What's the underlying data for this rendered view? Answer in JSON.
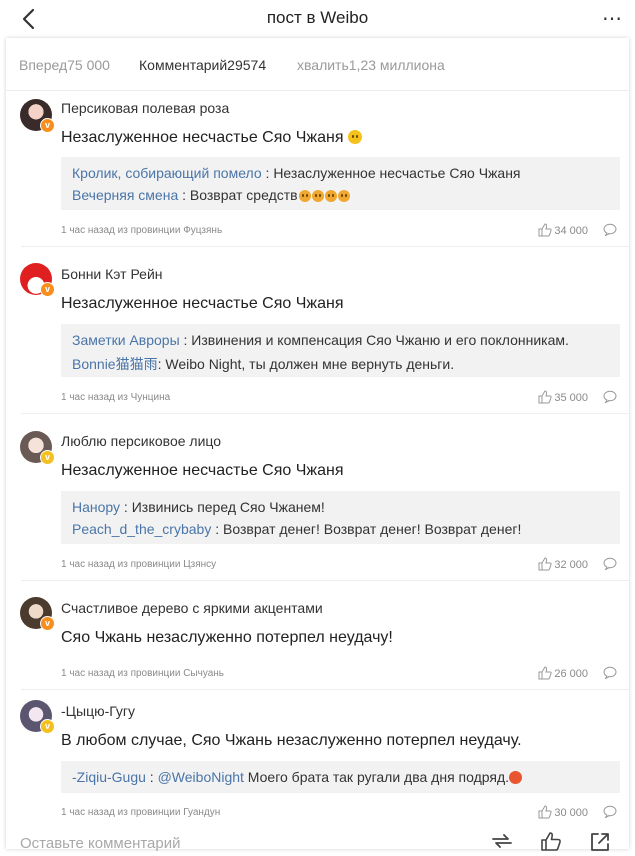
{
  "header": {
    "title": "пост в Weibo"
  },
  "tabs": {
    "forward": "Вперед75 000",
    "comments": "Комментарий29574",
    "likes": "хвалить1,23 миллиона"
  },
  "comments": [
    {
      "user": "Персиковая полевая роза",
      "text": "Незаслуженное несчастье Сяо Чжаня",
      "replies": [
        {
          "user": "Кролик, собирающий помело",
          "text": " : Незаслуженное несчастье Сяо Чжаня"
        },
        {
          "user": "Вечерняя смена",
          "text": " : Возврат средств"
        }
      ],
      "meta": "1 час назад из провинции Фуцзянь",
      "likes": "34 000"
    },
    {
      "user": "Бонни Кэт Рейн",
      "text": "Незаслуженное несчастье Сяо Чжаня",
      "replies": [
        {
          "user": "Заметки Авроры",
          "text": " : Извинения и компенсация Сяо Чжаню и его поклонникам."
        },
        {
          "user": "Bonnie猫猫雨",
          "text": ": Weibo Night, ты должен мне вернуть деньги."
        }
      ],
      "meta": "1 час назад из Чунцина",
      "likes": "35 000"
    },
    {
      "user": "Люблю персиковое лицо",
      "text": "Незаслуженное несчастье Сяо Чжаня",
      "replies": [
        {
          "user": "Нанору",
          "text": " : Извинись перед Сяо Чжанем!"
        },
        {
          "user": "Peach_d_the_crybaby",
          "text": " : Возврат денег! Возврат денег! Возврат денег!"
        }
      ],
      "meta": "1 час назад из провинции Цзянсу",
      "likes": "32 000"
    },
    {
      "user": "Счастливое дерево с яркими акцентами",
      "text": "Сяо Чжань незаслуженно потерпел неудачу!",
      "meta": "1 час назад из провинции Сычуань",
      "likes": "26 000"
    },
    {
      "user": "-Цыцю-Гугу",
      "text": "В любом случае, Сяо Чжань незаслуженно потерпел неудачу.",
      "replies": [
        {
          "user": "-Ziqiu-Gugu",
          "text": " : ",
          "mention": "@WeiboNight",
          "text2": " Моего брата так ругали два дня подряд."
        }
      ],
      "meta": "1 час назад из провинции Гуандун",
      "likes": "30 000"
    }
  ],
  "bottom": {
    "placeholder": "Оставьте комментарий"
  },
  "colors": {
    "link": "#4a75a8",
    "badge_orange": "#f78e1e",
    "badge_yellow": "#f4c01f"
  }
}
